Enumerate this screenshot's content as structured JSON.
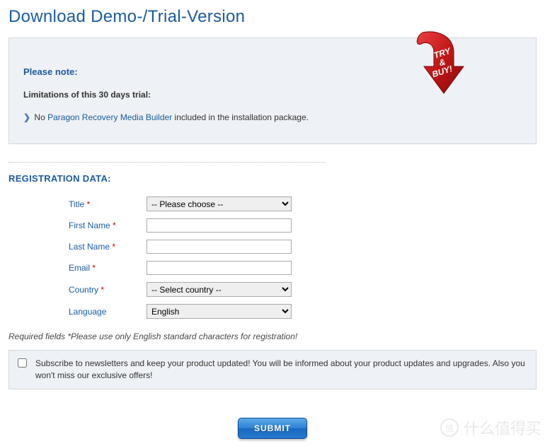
{
  "title": "Download Demo-/Trial-Version",
  "badge_text": "TRY & BUY!",
  "note": {
    "heading": "Please note:",
    "limit": "Limitations of this 30 days trial:",
    "prefix": "No",
    "link": "Paragon Recovery Media Builder",
    "suffix": " included in the installation package."
  },
  "section_heading": "REGISTRATION DATA:",
  "form": {
    "title": {
      "label": "Title",
      "required": true,
      "value": "-- Please choose --"
    },
    "first_name": {
      "label": "First Name",
      "required": true,
      "value": ""
    },
    "last_name": {
      "label": "Last Name",
      "required": true,
      "value": ""
    },
    "email": {
      "label": "Email",
      "required": true,
      "value": ""
    },
    "country": {
      "label": "Country",
      "required": true,
      "value": "-- Select country --"
    },
    "language": {
      "label": "Language",
      "required": false,
      "value": "English"
    }
  },
  "required_note": "Required fields *Please use only English standard characters for registration!",
  "subscribe_text": "Subscribe to newsletters and keep your product updated! You will be informed about your product updates and upgrades. Also you won't miss our exclusive offers!",
  "submit_label": "SUBMIT",
  "watermark": "什么值得买"
}
